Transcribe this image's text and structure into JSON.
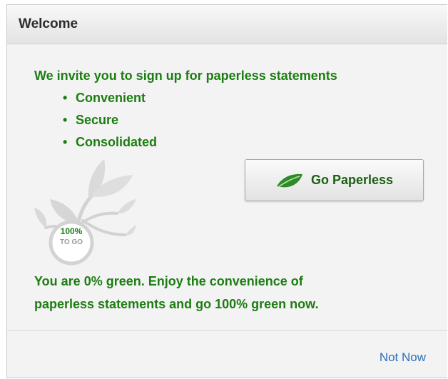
{
  "dialog": {
    "title": "Welcome"
  },
  "main": {
    "intro": "We invite you to sign up for paperless statements",
    "bullets": [
      "Convenient",
      "Secure",
      "Consolidated"
    ],
    "bullet_symbol": "•",
    "badge": {
      "percent": "100%",
      "caption": "TO GO"
    },
    "go_button": {
      "label": "Go Paperless",
      "icon": "leaf-icon"
    },
    "status_line1": "You are 0% green. Enjoy the convenience of",
    "status_line2": "paperless statements and go 100% green now."
  },
  "footer": {
    "not_now_label": "Not Now"
  },
  "colors": {
    "green_text": "#1c7d12",
    "link_blue": "#2a6fb7",
    "leaf_green": "#2f8a27"
  }
}
